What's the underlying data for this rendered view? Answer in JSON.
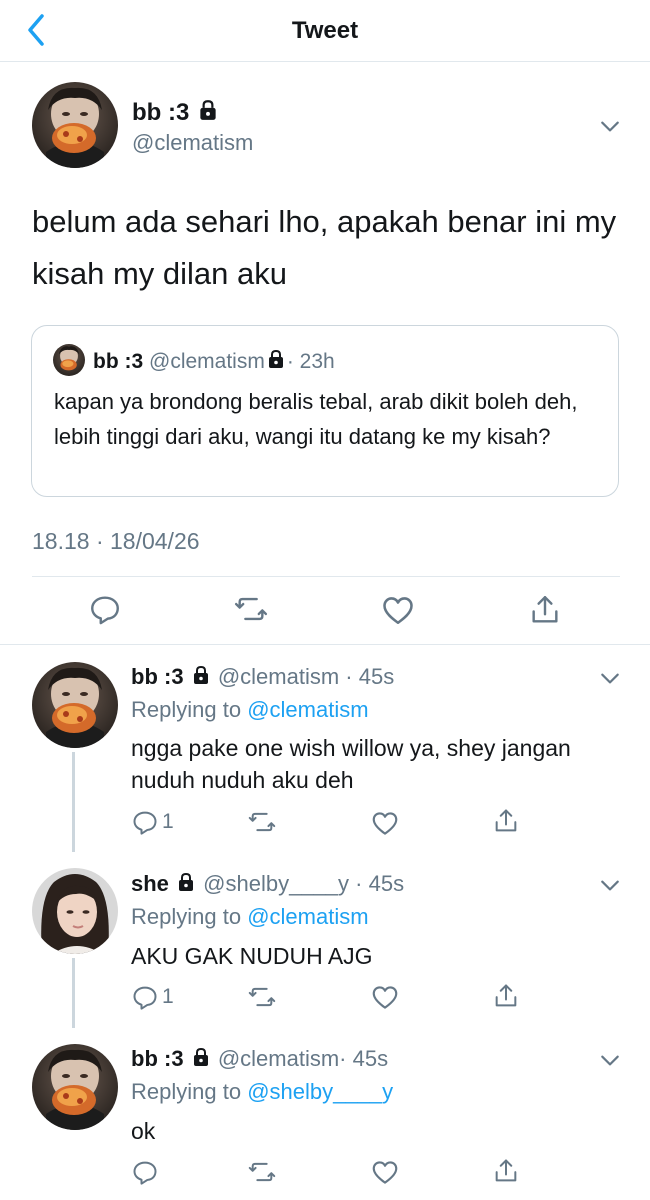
{
  "header": {
    "title": "Tweet"
  },
  "main_tweet": {
    "name": "bb :3",
    "handle": "@clematism",
    "text": "belum ada sehari lho, apakah benar ini my kisah my dilan aku",
    "timestamp": "18.18 · 18/04/26"
  },
  "quoted_tweet": {
    "name": "bb :3",
    "handle": "@clematism",
    "time": "· 23h",
    "text": "kapan ya brondong beralis tebal, arab dikit boleh deh, lebih tinggi dari aku, wangi itu datang ke my kisah?"
  },
  "replies": [
    {
      "name": "bb :3",
      "handle": "@clematism",
      "time": "· 45s",
      "replying_prefix": "Replying to",
      "replying_to": "@clematism",
      "text": "ngga pake one wish willow ya, shey jangan nuduh nuduh aku deh",
      "reply_count": "1"
    },
    {
      "name": "she",
      "handle": "@shelby____y",
      "time": "· 45s",
      "replying_prefix": "Replying to",
      "replying_to": "@clematism",
      "text": "AKU GAK NUDUH AJG",
      "reply_count": "1"
    },
    {
      "name": "bb :3",
      "handle": "@clematism",
      "time": "· 45s",
      "replying_prefix": "Replying to",
      "replying_to": "@shelby____y",
      "text": "ok",
      "reply_count": ""
    }
  ],
  "colors": {
    "accent": "#1da1f2",
    "secondary_text": "#657786",
    "icon": "#657786",
    "border": "#e1e8ed"
  }
}
